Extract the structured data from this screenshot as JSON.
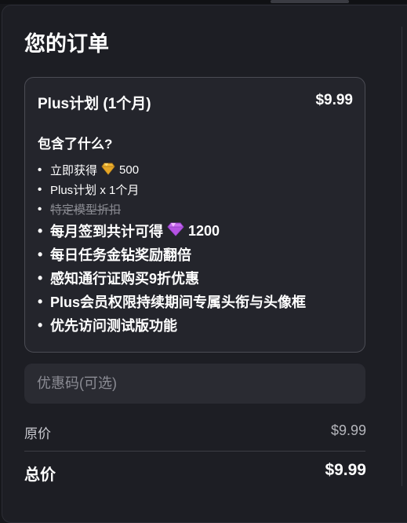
{
  "order": {
    "title": "您的订单",
    "plan_name": "Plus计划 (1个月)",
    "plan_price": "$9.99",
    "includes_heading": "包含了什么?",
    "features": [
      {
        "bullet": "•",
        "before": "立即获得",
        "icon": "gold-diamond-icon",
        "after": "500"
      },
      {
        "bullet": "•",
        "text": "Plus计划 x 1个月"
      },
      {
        "bullet": "•",
        "text": "特定模型折扣"
      },
      {
        "bullet": "•",
        "before": "每月签到共计可得",
        "icon": "purple-diamond-icon",
        "after": "1200"
      },
      {
        "bullet": "•",
        "text": "每日任务金钻奖励翻倍"
      },
      {
        "bullet": "•",
        "text": "感知通行证购买9折优惠"
      },
      {
        "bullet": "•",
        "text": "Plus会员权限持续期间专属头衔与头像框"
      },
      {
        "bullet": "•",
        "text": "优先访问测试版功能"
      }
    ],
    "promo_placeholder": "优惠码(可选)",
    "original_price_label": "原价",
    "original_price_value": "$9.99",
    "total_label": "总价",
    "total_value": "$9.99"
  },
  "colors": {
    "background": "#16171b",
    "panel": "#1d1e24",
    "card": "#24252c",
    "gold_diamond": "#f2b632",
    "purple_diamond": "#c86bf0"
  }
}
